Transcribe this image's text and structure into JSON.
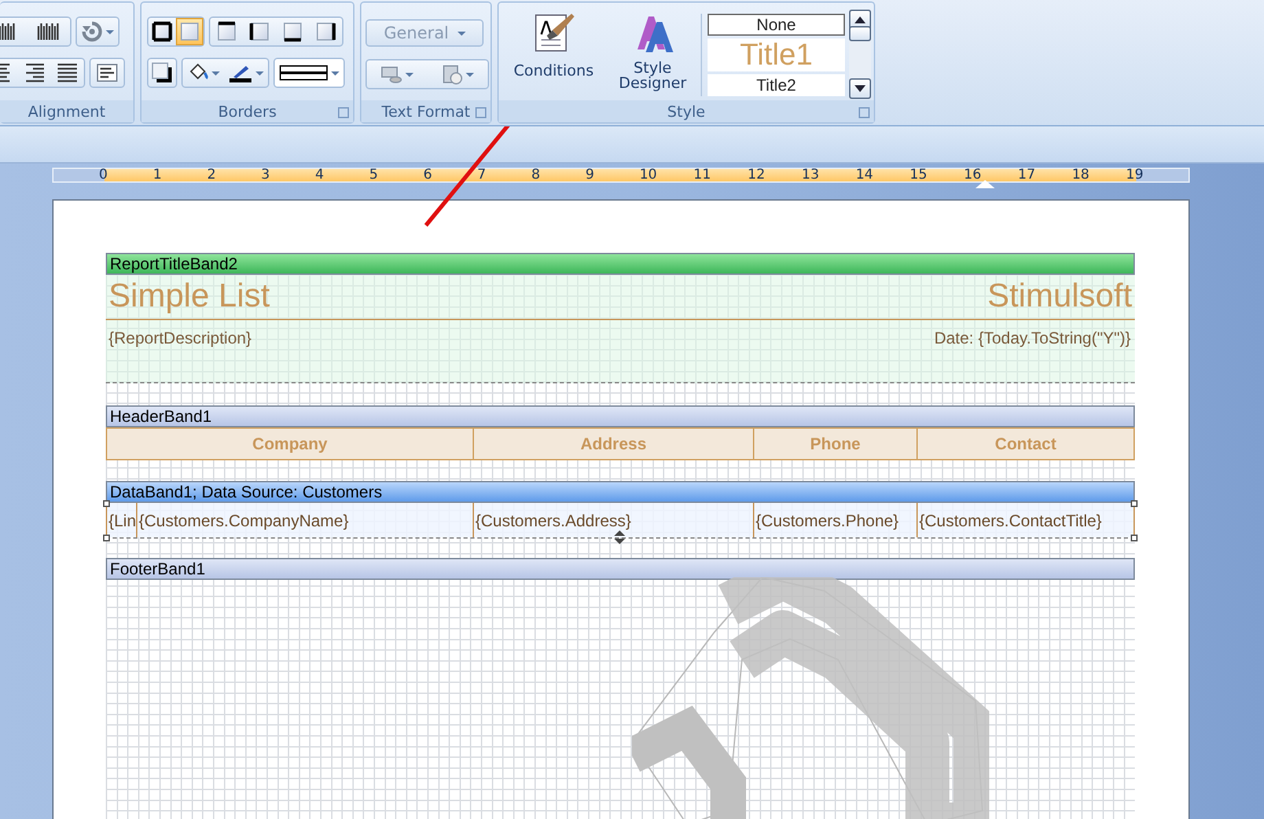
{
  "ribbon": {
    "alignment": {
      "title": "Alignment"
    },
    "borders": {
      "title": "Borders",
      "buttons": [
        {
          "kind": "all",
          "selected": false
        },
        {
          "kind": "none",
          "selected": true
        },
        {
          "kind": "top",
          "selected": false
        },
        {
          "kind": "left",
          "selected": false
        },
        {
          "kind": "bottom",
          "selected": false
        },
        {
          "kind": "right",
          "selected": false
        }
      ]
    },
    "text_format": {
      "title": "Text Format",
      "format": "General"
    },
    "style": {
      "title": "Style",
      "buttons": [
        {
          "kind": "conditions",
          "label": "Conditions"
        },
        {
          "kind": "designer",
          "label": "Style Designer"
        }
      ],
      "styles": [
        {
          "label": "None",
          "kind": "plain",
          "selected": true
        },
        {
          "label": "Title1",
          "kind": "title",
          "selected": false
        },
        {
          "label": "Title2",
          "kind": "plain",
          "selected": false
        }
      ]
    }
  },
  "ruler": {
    "labels": [
      "0",
      "1",
      "2",
      "3",
      "4",
      "5",
      "6",
      "7",
      "8",
      "9",
      "10",
      "11",
      "12",
      "13",
      "14",
      "15",
      "16",
      "17",
      "18",
      "19"
    ]
  },
  "report": {
    "title_band": {
      "header": "ReportTitleBand2",
      "title": "Simple List",
      "company": "Stimulsoft",
      "description": "{ReportDescription}",
      "date": "Date: {Today.ToString(\"Y\")}"
    },
    "header_band": {
      "header": "HeaderBand1",
      "columns": [
        "Company",
        "Address",
        "Phone",
        "Contact"
      ]
    },
    "data_band": {
      "header": "DataBand1; Data Source: Customers",
      "selected": true,
      "cells": [
        "{Lin",
        "{Customers.CompanyName}",
        "{Customers.Address}",
        "{Customers.Phone}",
        "{Customers.ContactTitle}"
      ]
    },
    "footer_band": {
      "header": "FooterBand1"
    }
  }
}
